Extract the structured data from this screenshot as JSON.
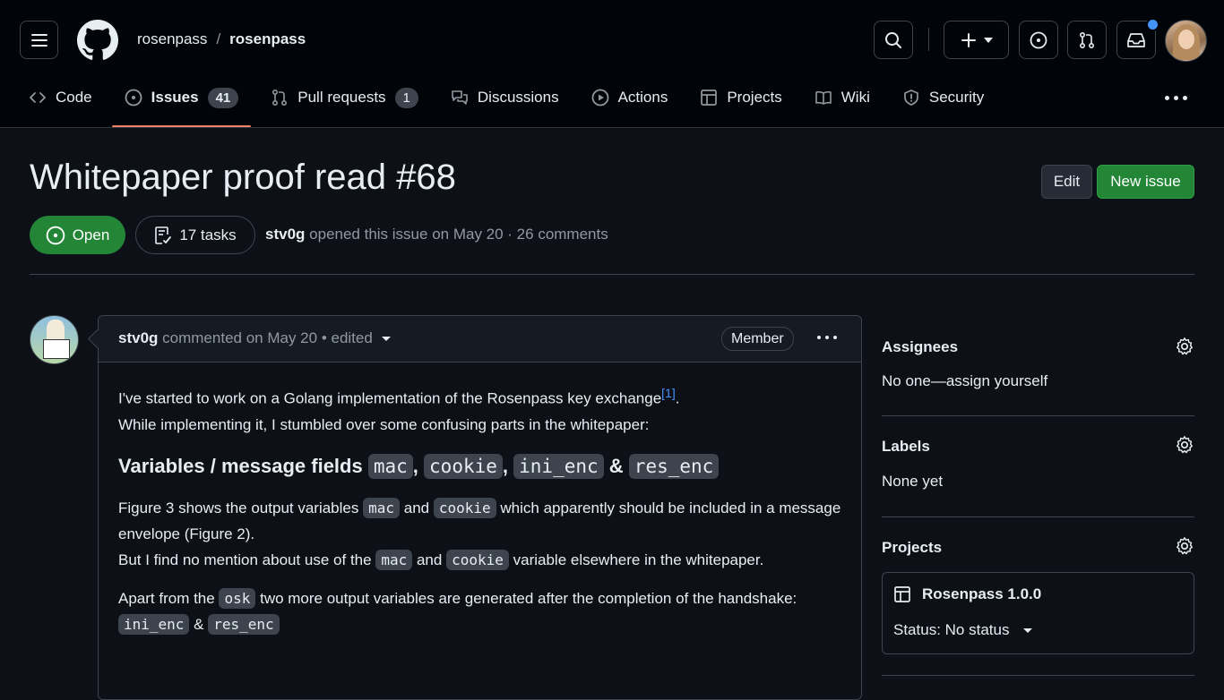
{
  "header": {
    "owner": "rosenpass",
    "separator": "/",
    "repo": "rosenpass"
  },
  "tabs": [
    {
      "label": "Code",
      "icon": "code-icon"
    },
    {
      "label": "Issues",
      "count": "41",
      "icon": "issue-opened-icon",
      "active": true
    },
    {
      "label": "Pull requests",
      "count": "1",
      "icon": "git-pull-request-icon"
    },
    {
      "label": "Discussions",
      "icon": "comment-discussion-icon"
    },
    {
      "label": "Actions",
      "icon": "play-icon"
    },
    {
      "label": "Projects",
      "icon": "table-icon"
    },
    {
      "label": "Wiki",
      "icon": "book-icon"
    },
    {
      "label": "Security",
      "icon": "shield-icon"
    }
  ],
  "issue": {
    "title": "Whitepaper proof read",
    "number": "#68",
    "edit_label": "Edit",
    "new_issue_label": "New issue",
    "state": "Open",
    "tasks": "17 tasks",
    "author": "stv0g",
    "meta_rest": "opened this issue on May 20 · 26 comments"
  },
  "comment": {
    "author": "stv0g",
    "action": "commented on May 20",
    "edited": "• edited",
    "badge": "Member",
    "p1_a": "I've started to work on a Golang implementation of the Rosenpass key exchange",
    "p1_sup": "[1]",
    "p1_b": ".",
    "p1_c": "While implementing it, I stumbled over some confusing parts in the whitepaper:",
    "h_text": "Variables / message fields",
    "code_mac": "mac",
    "code_cookie": "cookie",
    "code_ini_enc": "ini_enc",
    "code_res_enc": "res_enc",
    "code_osk": "osk",
    "comma": ",",
    "amp": "&",
    "p2_a": "Figure 3 shows the output variables",
    "and": "and",
    "p2_b": "which apparently should be included in a message envelope (Figure 2).",
    "p3_a": "But I find no mention about use of the",
    "p3_b": "variable elsewhere in the whitepaper.",
    "p4_a": "Apart from the",
    "p4_b": "two more output variables are generated after the completion of the handshake:"
  },
  "sidebar": {
    "assignees_title": "Assignees",
    "assignees_value": "No one—assign yourself",
    "labels_title": "Labels",
    "labels_value": "None yet",
    "projects_title": "Projects",
    "project_name": "Rosenpass 1.0.0",
    "project_status": "Status: No status"
  },
  "colors": {
    "background": "#0d1117",
    "header": "#010409",
    "green": "#238636",
    "accent_underline": "#f78166",
    "link": "#4493f8"
  }
}
